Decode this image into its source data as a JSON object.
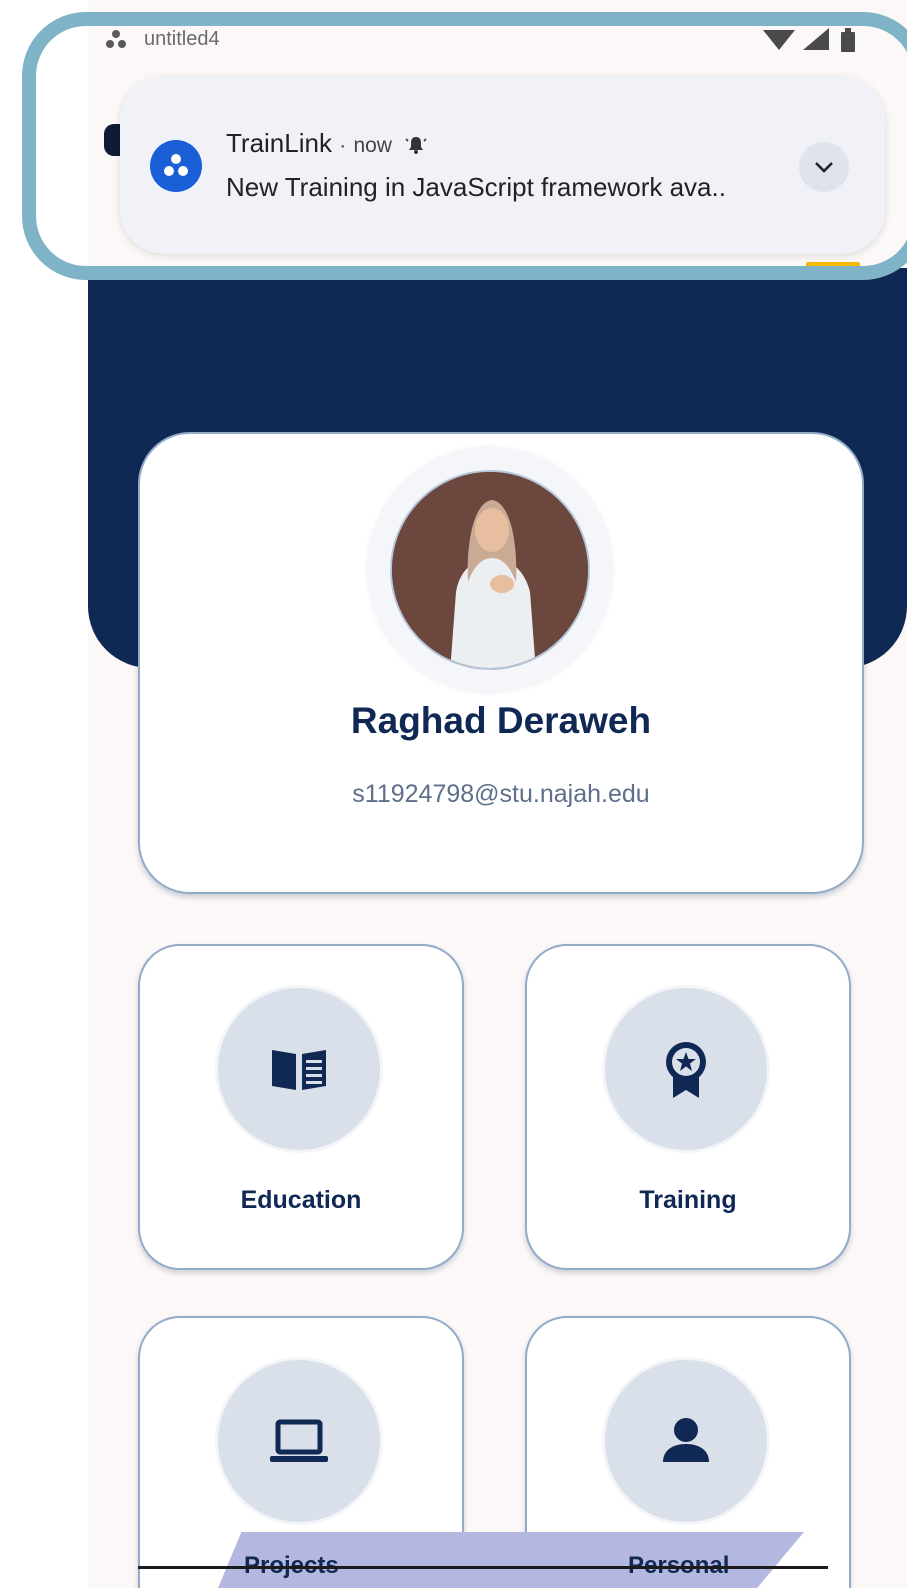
{
  "status_bar": {
    "app_name": "untitled4"
  },
  "notification": {
    "app": "TrainLink",
    "separator": "·",
    "time": "now",
    "body": "New Training in JavaScript framework ava..",
    "badge_color": "#1a5fd6",
    "icons": [
      "app-logo-icon",
      "bell-icon",
      "chevron-down-icon"
    ]
  },
  "profile": {
    "name": "Raghad Deraweh",
    "email": "s11924798@stu.najah.edu"
  },
  "tiles": [
    {
      "label": "Education",
      "icon": "book-icon"
    },
    {
      "label": "Training",
      "icon": "award-badge-icon"
    },
    {
      "label": "Projects",
      "icon": "laptop-icon"
    },
    {
      "label": "Personal",
      "icon": "person-icon"
    }
  ],
  "colors": {
    "primary": "#0f2854",
    "background": "#fcf8f8",
    "tile_circle": "#d9e0e9",
    "annotation_frame": "#7fb3c8"
  }
}
